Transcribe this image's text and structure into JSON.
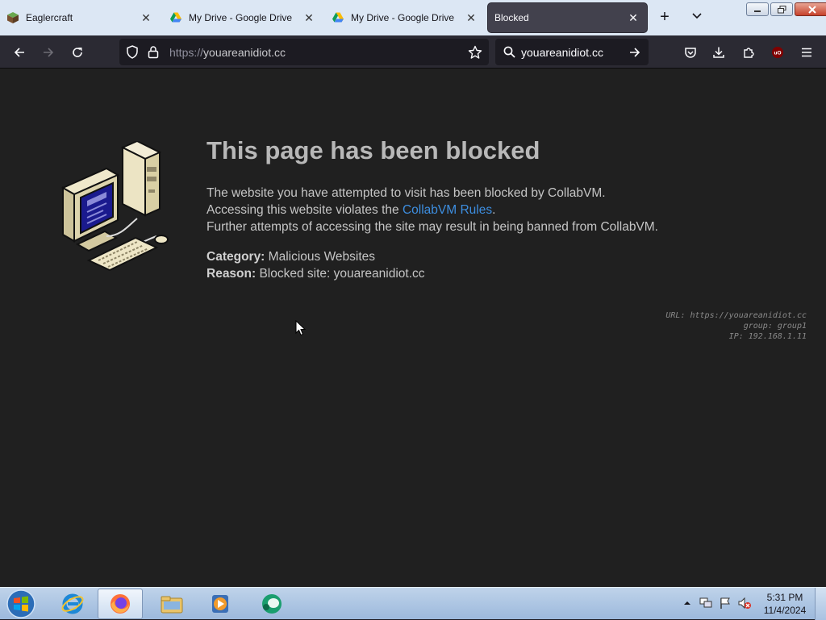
{
  "tabs": [
    {
      "title": "Eaglercraft",
      "favicon": "minecraft-block-icon",
      "active": false
    },
    {
      "title": "My Drive - Google Drive",
      "favicon": "google-drive-icon",
      "active": false
    },
    {
      "title": "My Drive - Google Drive",
      "favicon": "google-drive-icon",
      "active": false
    },
    {
      "title": "Blocked",
      "favicon": "none",
      "active": true
    }
  ],
  "urlbar": {
    "protocol": "https://",
    "host": "youareanidiot.cc"
  },
  "searchbar": {
    "query": "youareanidiot.cc"
  },
  "page": {
    "heading": "This page has been blocked",
    "line1": "The website you have attempted to visit has been blocked by CollabVM.",
    "line2_prefix": "Accessing this website violates the ",
    "line2_link": "CollabVM Rules",
    "line2_suffix": ".",
    "line3": "Further attempts of accessing the site may result in being banned from CollabVM.",
    "category_label": "Category:",
    "category_value": "Malicious Websites",
    "reason_label": "Reason:",
    "reason_value": "Blocked site: youareanidiot.cc",
    "meta_url": "URL: https://youareanidiot.cc",
    "meta_group": "group: group1",
    "meta_ip": "IP: 192.168.1.11"
  },
  "taskbar": {
    "time": "5:31 PM",
    "date": "11/4/2024",
    "pinned": [
      "internet-explorer-icon",
      "firefox-icon",
      "file-explorer-icon",
      "media-player-icon",
      "chat-app-icon"
    ]
  },
  "colors": {
    "link": "#3d8ee0",
    "page_bg": "#202020",
    "toolbar_bg": "#2b2a33",
    "tabstrip_bg": "#dce7f4"
  }
}
